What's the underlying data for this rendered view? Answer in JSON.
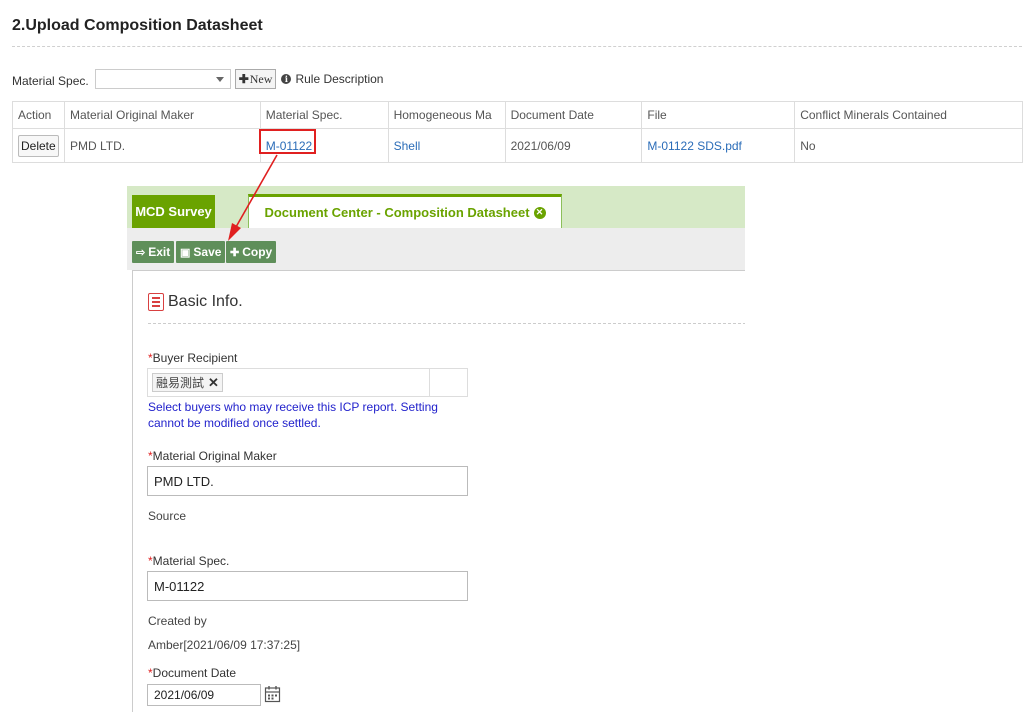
{
  "page": {
    "section_title": "2.Upload Composition Datasheet"
  },
  "filter": {
    "label": "Material Spec.",
    "select_value": "",
    "new_button": "New",
    "rule_description": "Rule Description"
  },
  "table": {
    "headers": [
      "Action",
      "Material Original Maker",
      "Material Spec.",
      "Homogeneous Ma",
      "Document Date",
      "File",
      "Conflict Minerals Contained"
    ],
    "rows": [
      {
        "action": "Delete",
        "maker": "PMD LTD.",
        "spec": "M-01122",
        "homogeneous": "Shell",
        "date": "2021/06/09",
        "file": "M-01122 SDS.pdf",
        "conflict": "No"
      }
    ]
  },
  "panel": {
    "tabs": [
      "MCD Survey",
      "Document Center - Composition Datasheet"
    ],
    "toolbar": [
      "Exit",
      "Save",
      "Copy"
    ],
    "basic_info": "Basic Info.",
    "buyer_label": "Buyer Recipient",
    "buyer_chip": "融易測試",
    "buyer_hint": "Select buyers who may receive this ICP report. Setting cannot be modified once settled.",
    "maker_label": "Material Original Maker",
    "maker_value": "PMD LTD.",
    "source_label": "Source",
    "spec_label": "Material Spec.",
    "spec_value": "M-01122",
    "created_by_label": "Created by",
    "created_by_value": "Amber[2021/06/09 17:37:25]",
    "doc_date_label": "Document Date",
    "doc_date_value": "2021/06/09",
    "required_mark": "*"
  },
  "colors": {
    "tab_green": "#6aa300",
    "toolbar_button": "#5f8f5a",
    "link": "#2a6cb8",
    "highlight_red": "#e02020",
    "hint_blue": "#2222cc"
  }
}
